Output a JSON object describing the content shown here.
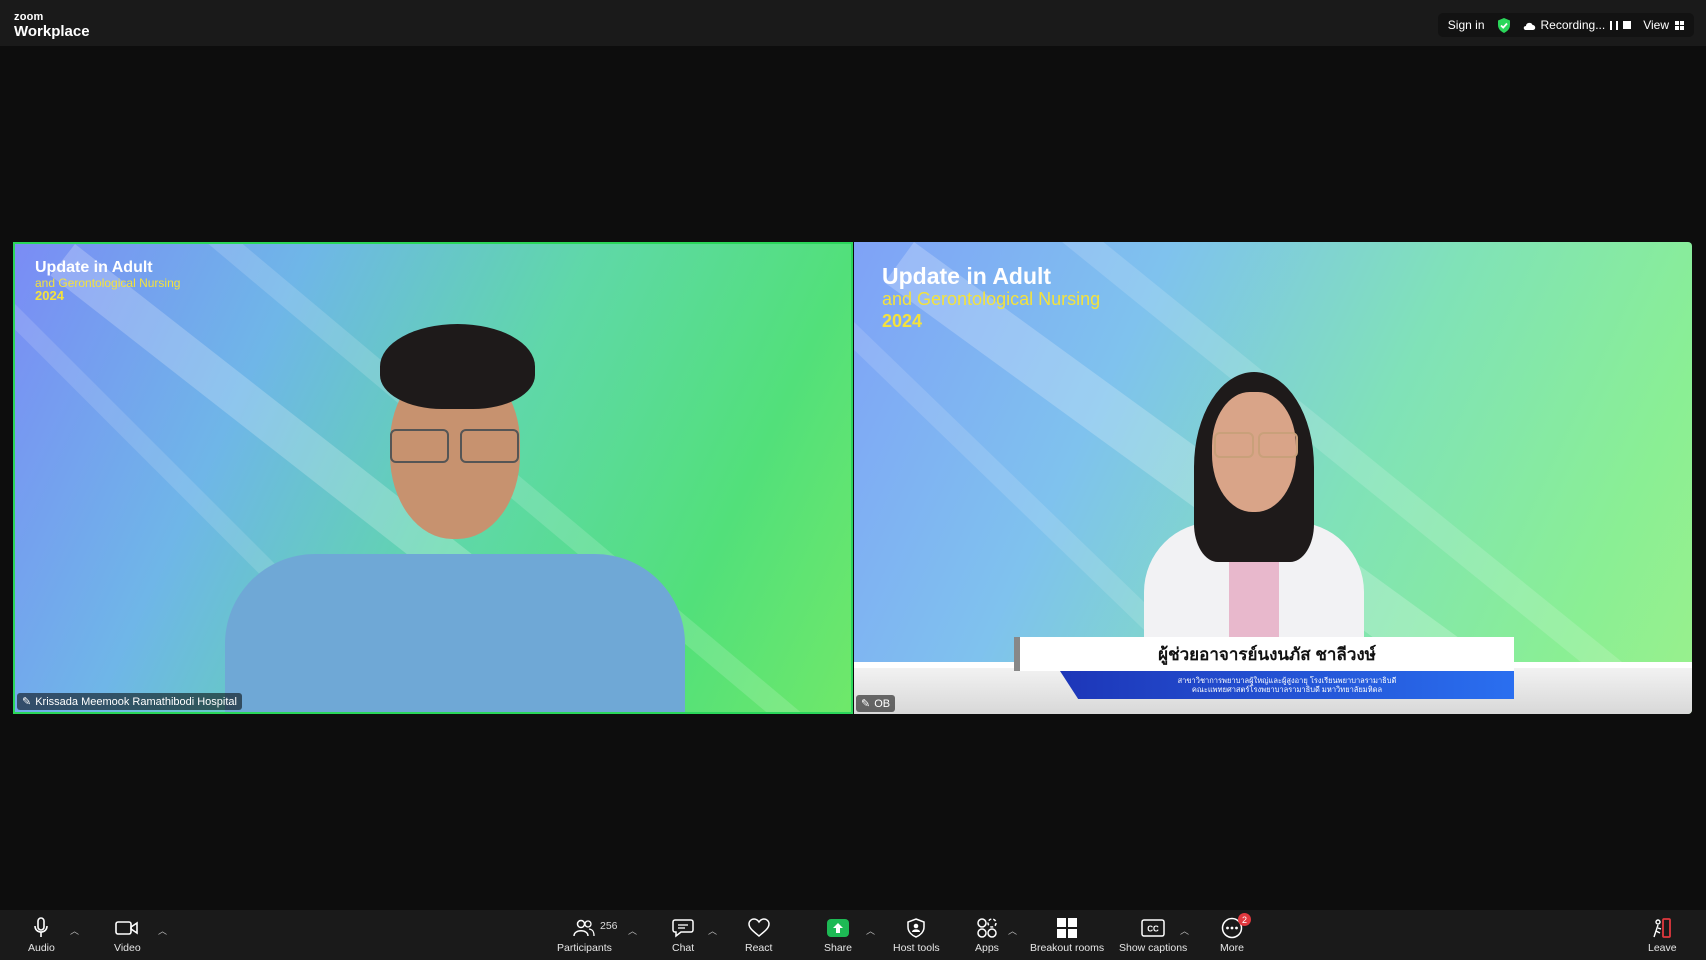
{
  "app": {
    "brand_small": "zoom",
    "brand_name": "Workplace"
  },
  "topbar": {
    "sign_in": "Sign in",
    "recording": "Recording...",
    "view": "View"
  },
  "tiles": [
    {
      "title_line1": "Update in Adult",
      "title_line2": "and Gerontological Nursing",
      "title_line3": "2024",
      "name": "Krissada Meemook Ramathibodi Hospital"
    },
    {
      "title_line1": "Update in Adult",
      "title_line2": "and Gerontological Nursing",
      "title_line3": "2024",
      "name": "OB",
      "lower_third_name": "ผู้ช่วยอาจารย์นงนภัส ชาลีวงษ์",
      "lower_third_line1": "สาขาวิชาการพยาบาลผู้ใหญ่และผู้สูงอายุ โรงเรียนพยาบาลรามาธิบดี",
      "lower_third_line2": "คณะแพทยศาสตร์โรงพยาบาลรามาธิบดี มหาวิทยาลัยมหิดล"
    }
  ],
  "toolbar": {
    "audio": "Audio",
    "video": "Video",
    "participants": "Participants",
    "participant_count": "256",
    "chat": "Chat",
    "react": "React",
    "share": "Share",
    "host_tools": "Host tools",
    "apps": "Apps",
    "breakout_rooms": "Breakout rooms",
    "show_captions": "Show captions",
    "more": "More",
    "more_badge": "2",
    "leave": "Leave"
  },
  "colors": {
    "active_speaker": "#2ad65a",
    "share_green": "#1db954",
    "badge_red": "#e0383e",
    "accent_yellow": "#f4e23c"
  }
}
